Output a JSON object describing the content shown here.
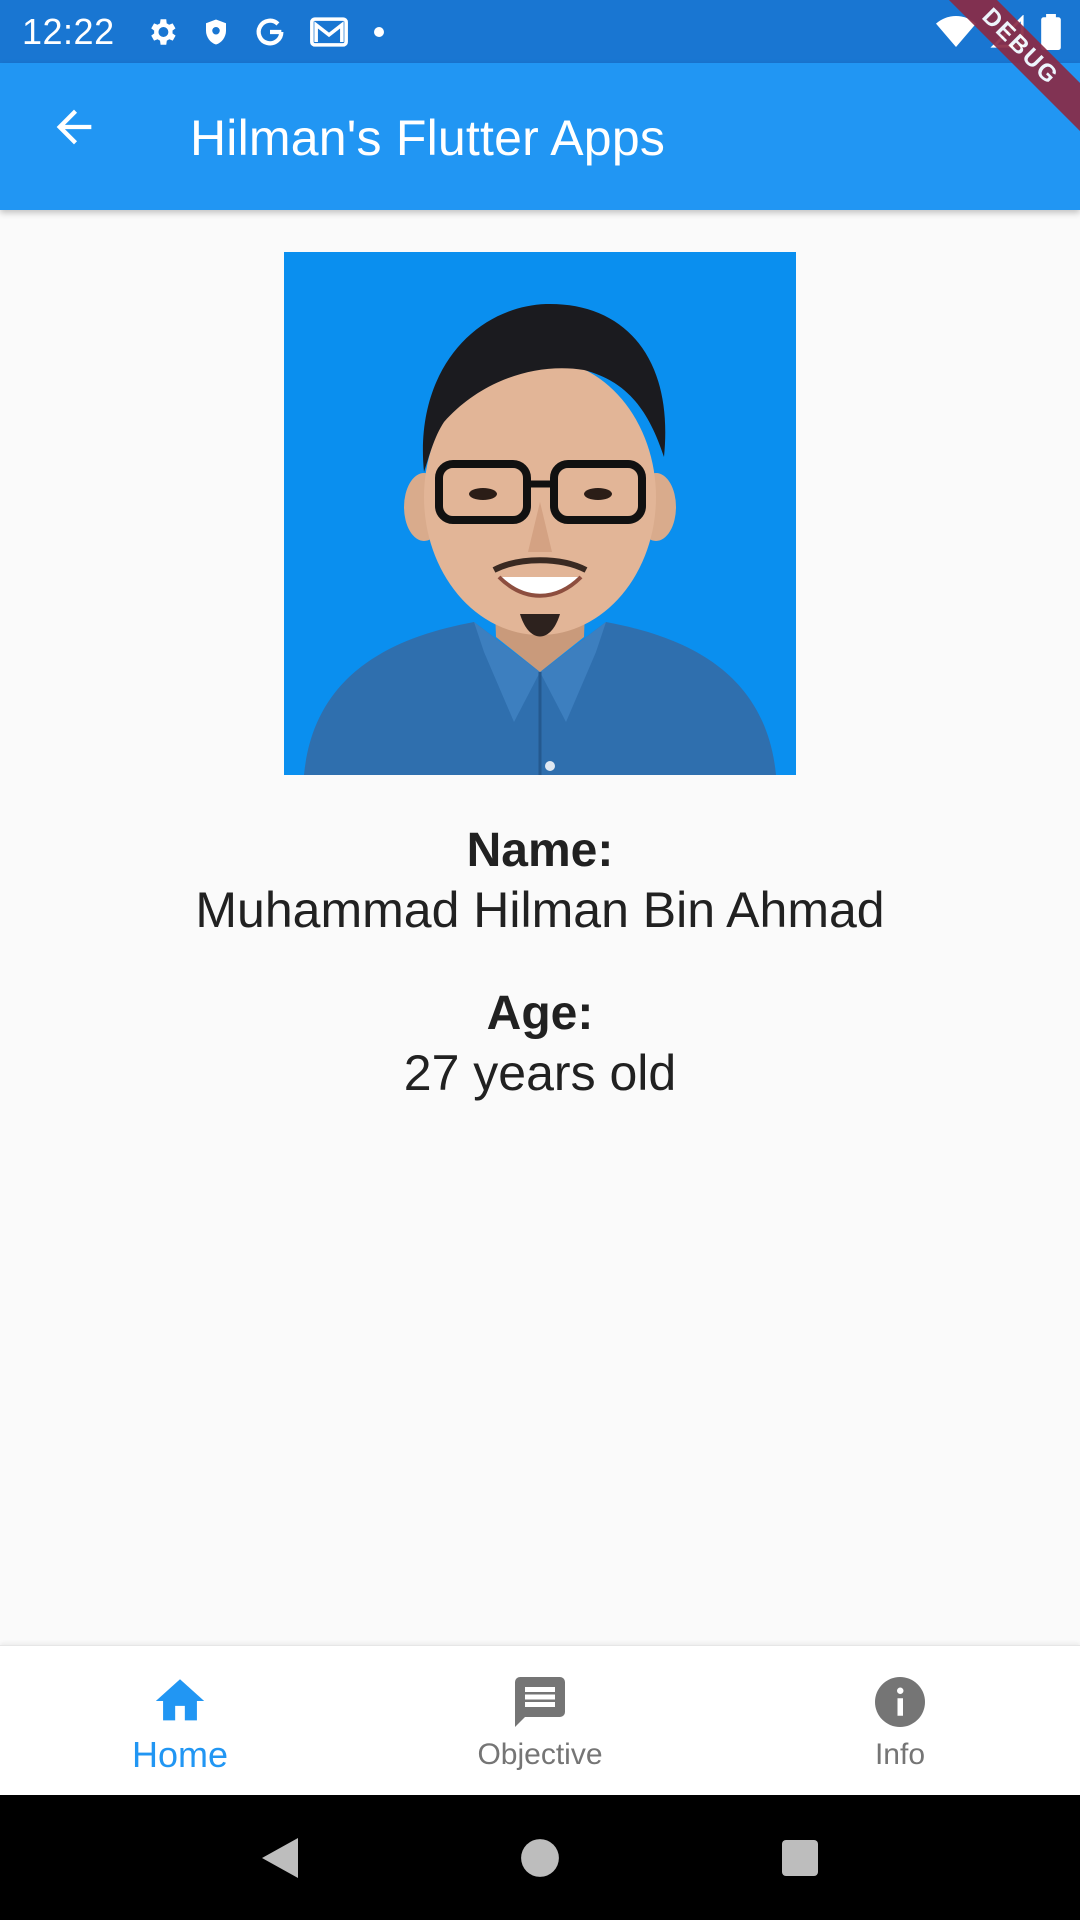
{
  "status_bar": {
    "time": "12:22",
    "icons": [
      "settings-icon",
      "shield-icon",
      "google-icon",
      "gmail-icon",
      "dot-icon",
      "wifi-icon",
      "signal-icon",
      "battery-icon"
    ]
  },
  "app_bar": {
    "title": "Hilman's Flutter Apps",
    "back_icon": "arrow-back-icon",
    "color": "#2196f3"
  },
  "debug_banner": {
    "label": "DEBUG",
    "color": "#8a2b46"
  },
  "profile": {
    "name_label": "Name:",
    "name_value": "Muhammad Hilman Bin Ahmad",
    "age_label": "Age:",
    "age_value": "27 years old",
    "photo_background": "#0a8fef"
  },
  "bottom_nav": {
    "items": [
      {
        "label": "Home",
        "icon": "home-icon",
        "active": true
      },
      {
        "label": "Objective",
        "icon": "message-icon",
        "active": false
      },
      {
        "label": "Info",
        "icon": "info-icon",
        "active": false
      }
    ],
    "active_color": "#2196f3",
    "inactive_color": "#757575"
  },
  "system_nav": {
    "buttons": [
      "back-triangle-icon",
      "home-circle-icon",
      "recents-square-icon"
    ]
  }
}
